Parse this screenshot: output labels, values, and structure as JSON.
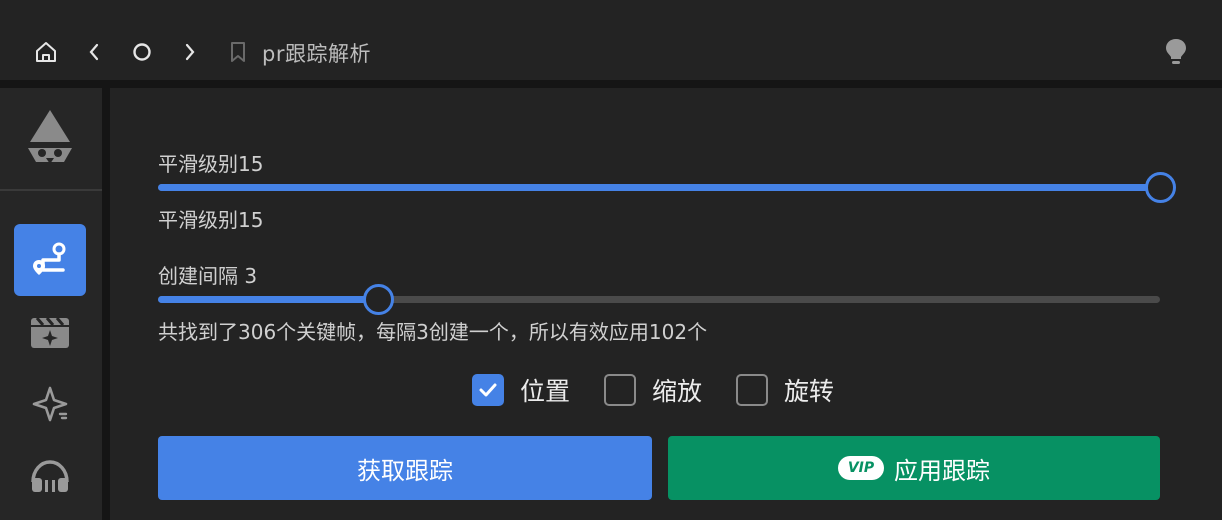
{
  "header": {
    "title": "pr跟踪解析",
    "icons": [
      "home-icon",
      "back-icon",
      "refresh-icon",
      "forward-icon",
      "bookmark-icon",
      "lightbulb-icon"
    ]
  },
  "sidebar": {
    "items": [
      {
        "icon": "spade-logo-icon",
        "active": false
      },
      {
        "icon": "route-tracking-icon",
        "active": true
      },
      {
        "icon": "film-sparkle-icon",
        "active": false
      },
      {
        "icon": "star-sparkle-icon",
        "active": false
      },
      {
        "icon": "headphones-icon",
        "active": false
      }
    ]
  },
  "smoothing": {
    "label": "平滑级别15",
    "value_text": "平滑级别15",
    "level": 1.0
  },
  "interval": {
    "label": "创建间隔 3",
    "level": 0.22,
    "summary": "共找到了306个关键帧，每隔3创建一个，所以有效应用102个"
  },
  "options": [
    {
      "label": "位置",
      "checked": true
    },
    {
      "label": "缩放",
      "checked": false
    },
    {
      "label": "旋转",
      "checked": false
    }
  ],
  "buttons": {
    "get_tracking": "获取跟踪",
    "apply_tracking": "应用跟踪",
    "vip_badge": "VIP"
  },
  "colors": {
    "accent": "#4582e6",
    "apply": "#079163",
    "background": "#232323"
  }
}
